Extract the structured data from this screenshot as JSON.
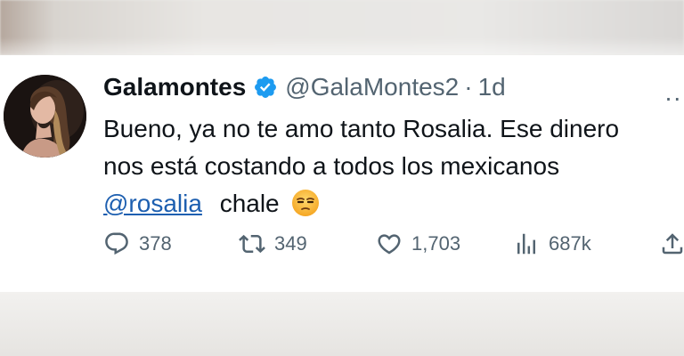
{
  "tweet": {
    "author_name": "Galamontes",
    "handle": "@GalaMontes2",
    "separator": "·",
    "time": "1d",
    "more_label": "...",
    "text_line1": "Bueno, ya no te amo tanto Rosalia. Ese dinero",
    "text_line2": "nos está costando a todos los mexicanos",
    "mention": "@rosalia",
    "text_line3_rest": "chale",
    "emoji": "unamused-face-emoji",
    "verified_icon": "verified-badge-icon",
    "colors": {
      "text": "#0f1419",
      "muted": "#536471",
      "link": "#1d5fb0",
      "verified": "#1d9bf0"
    }
  },
  "actions": {
    "replies": "378",
    "retweets": "349",
    "likes": "1,703",
    "views": "687k"
  }
}
